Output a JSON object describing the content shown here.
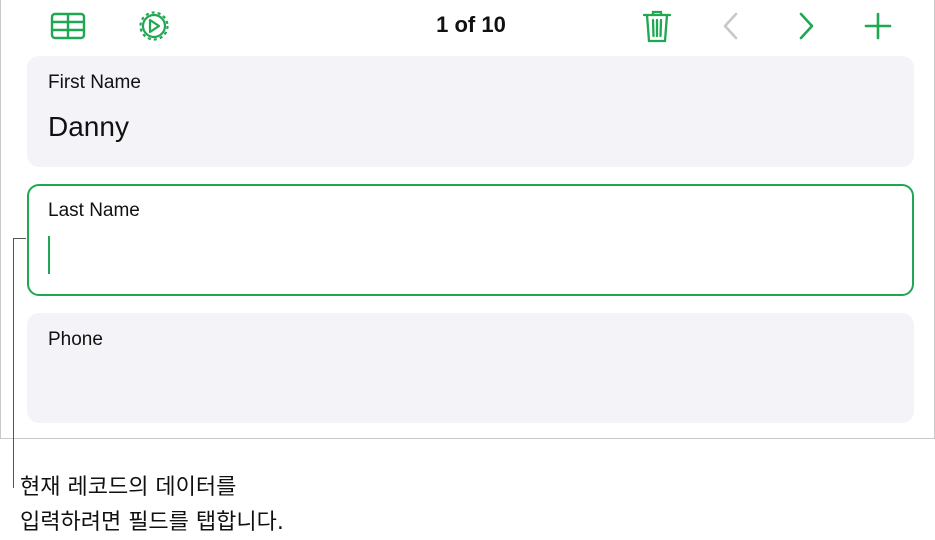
{
  "toolbar": {
    "table_icon": "table-grid-icon",
    "settings_icon": "gear-icon",
    "record_counter": "1 of 10",
    "delete_icon": "trash-icon",
    "prev_icon": "chevron-left-icon",
    "next_icon": "chevron-right-icon",
    "add_icon": "plus-icon"
  },
  "form": {
    "fields": [
      {
        "label": "First Name",
        "value": "Danny",
        "active": false
      },
      {
        "label": "Last Name",
        "value": "",
        "active": true
      },
      {
        "label": "Phone",
        "value": "",
        "active": false
      }
    ]
  },
  "callout": {
    "line1": "현재 레코드의 데이터를",
    "line2": "입력하려면 필드를 탭합니다."
  },
  "colors": {
    "accent": "#1fa751",
    "disabled": "#c7c7cc",
    "field_bg": "#f3f3f8"
  }
}
